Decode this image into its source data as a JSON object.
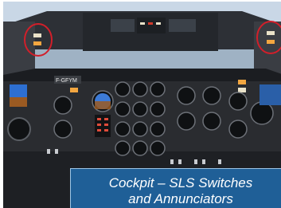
{
  "caption": {
    "line1": "Cockpit – SLS Switches",
    "line2": "and Annunciators"
  },
  "instrument_panel": {
    "registration_placard": "F-GFYM"
  },
  "annotations": {
    "highlight_circles": 2,
    "highlight_color": "#d21f2a"
  },
  "colors": {
    "caption_background": "#1f5f97",
    "caption_text": "#ffffff"
  }
}
